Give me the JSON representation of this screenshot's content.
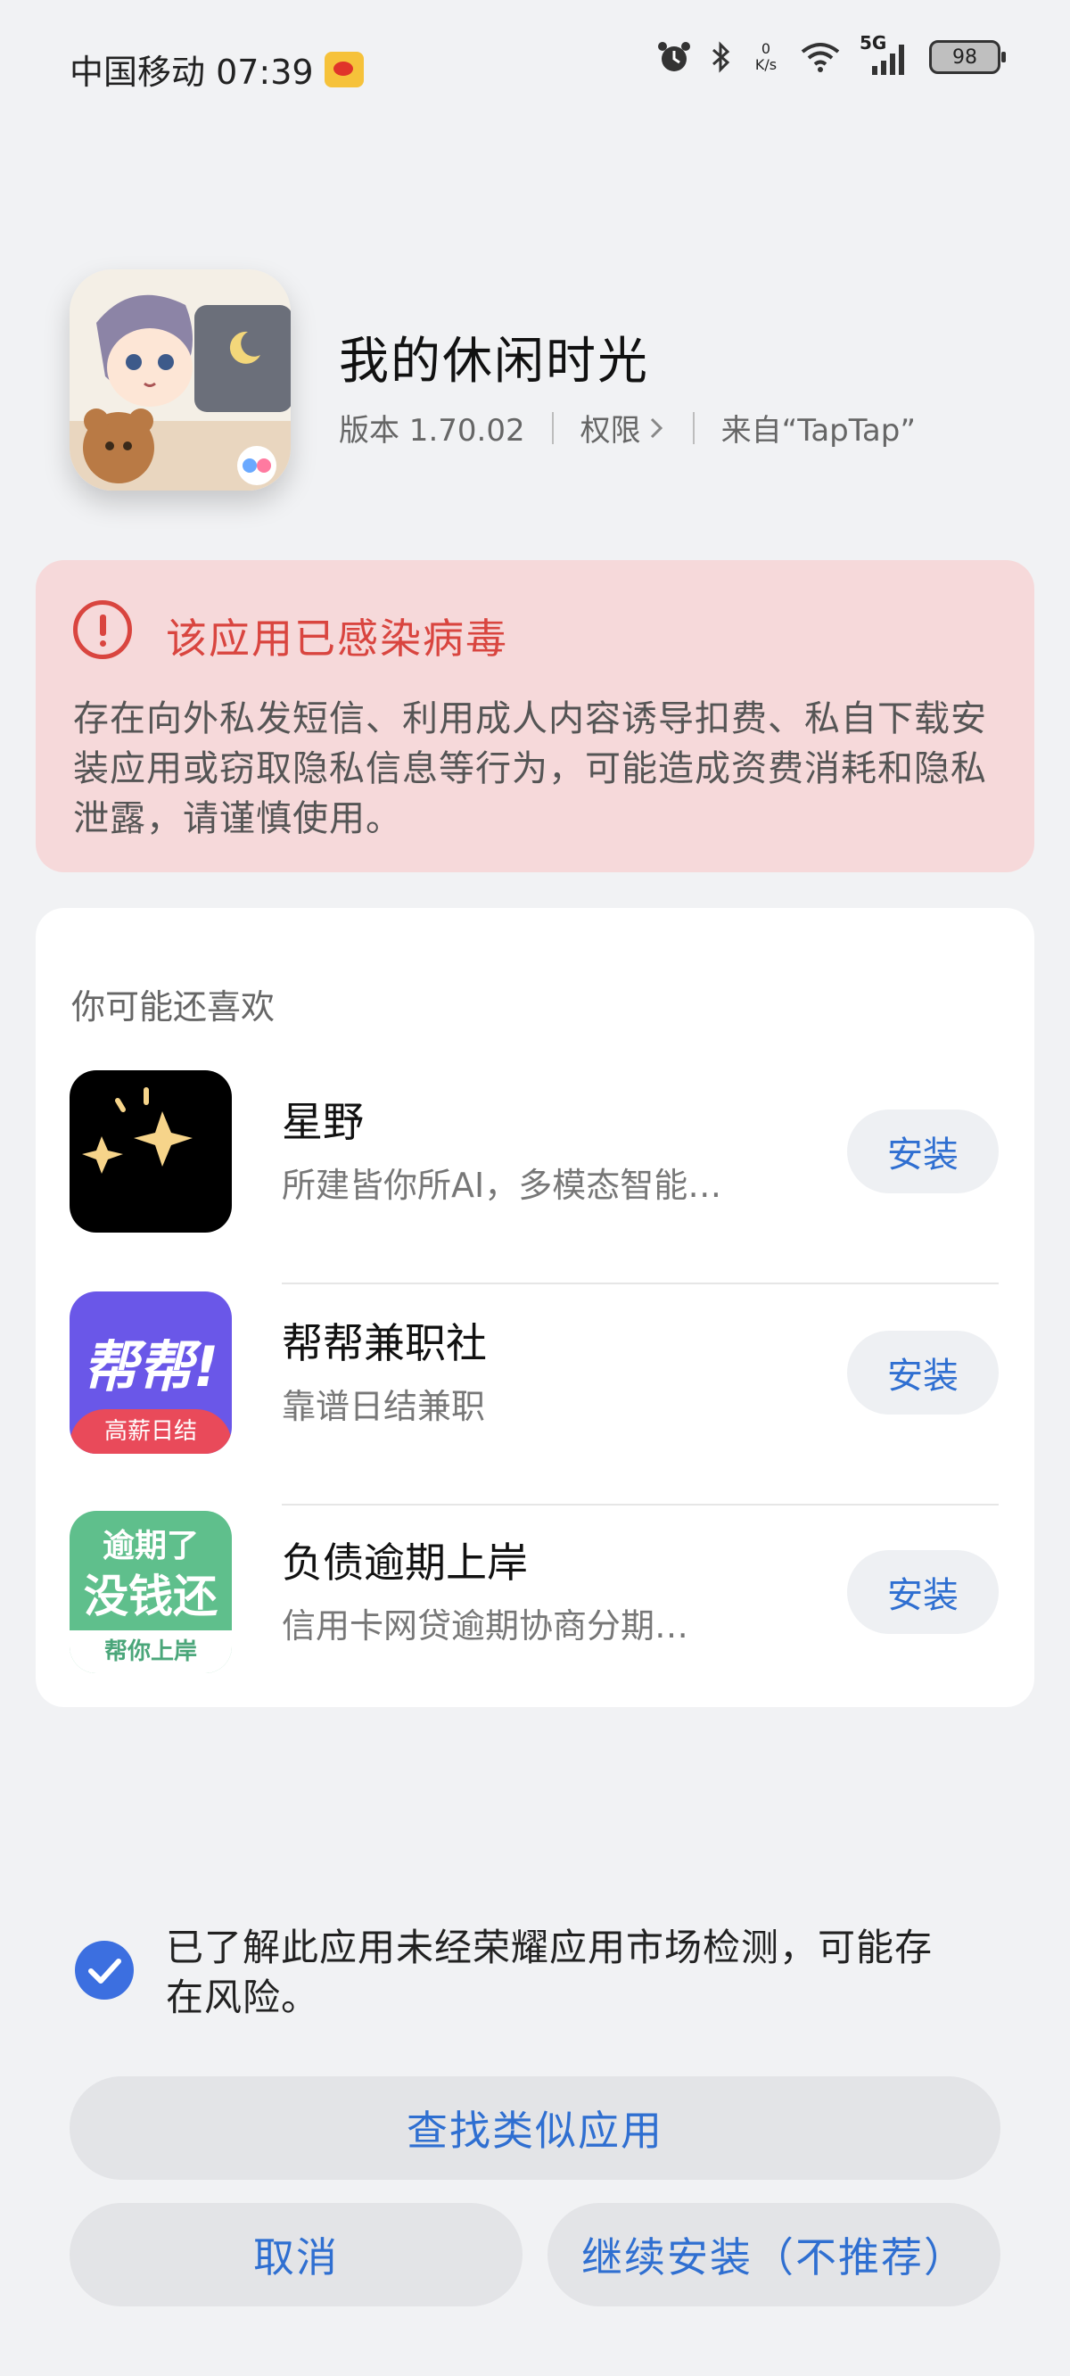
{
  "status_bar": {
    "carrier_time": "中国移动 07:39",
    "net_speed_value": "0",
    "net_speed_unit": "K/s",
    "network_type": "5G",
    "battery": "98"
  },
  "app": {
    "name": "我的休闲时光",
    "version": "版本 1.70.02",
    "permission_label": "权限",
    "source": "来自“TapTap”"
  },
  "warning": {
    "title": "该应用已感染病毒",
    "text": "存在向外私发短信、利用成人内容诱导扣费、私自下载安装应用或窃取隐私信息等行为，可能造成资费消耗和隐私泄露，请谨慎使用。"
  },
  "recommend": {
    "title": "你可能还喜欢",
    "items": [
      {
        "name": "星野",
        "desc": "所建皆你所AI，多模态智能…",
        "button": "安装"
      },
      {
        "name": "帮帮兼职社",
        "desc": "靠谱日结兼职",
        "button": "安装",
        "icon_text_top": "帮帮!",
        "icon_text_bottom": "高薪日结"
      },
      {
        "name": "负债逾期上岸",
        "desc": "信用卡网贷逾期协商分期…",
        "button": "安装",
        "icon_text_top": "逾期了",
        "icon_text_mid": "没钱还",
        "icon_text_bottom": "帮你上岸"
      }
    ]
  },
  "footer": {
    "ack_text": "已了解此应用未经荣耀应用市场检测，可能存在风险。",
    "find_similar": "查找类似应用",
    "cancel": "取消",
    "continue": "继续安装（不推荐）"
  },
  "colors": {
    "accent": "#2f6fd1",
    "danger": "#d9453f",
    "warning_bg": "#f6d9da",
    "check": "#3c6fe0"
  }
}
